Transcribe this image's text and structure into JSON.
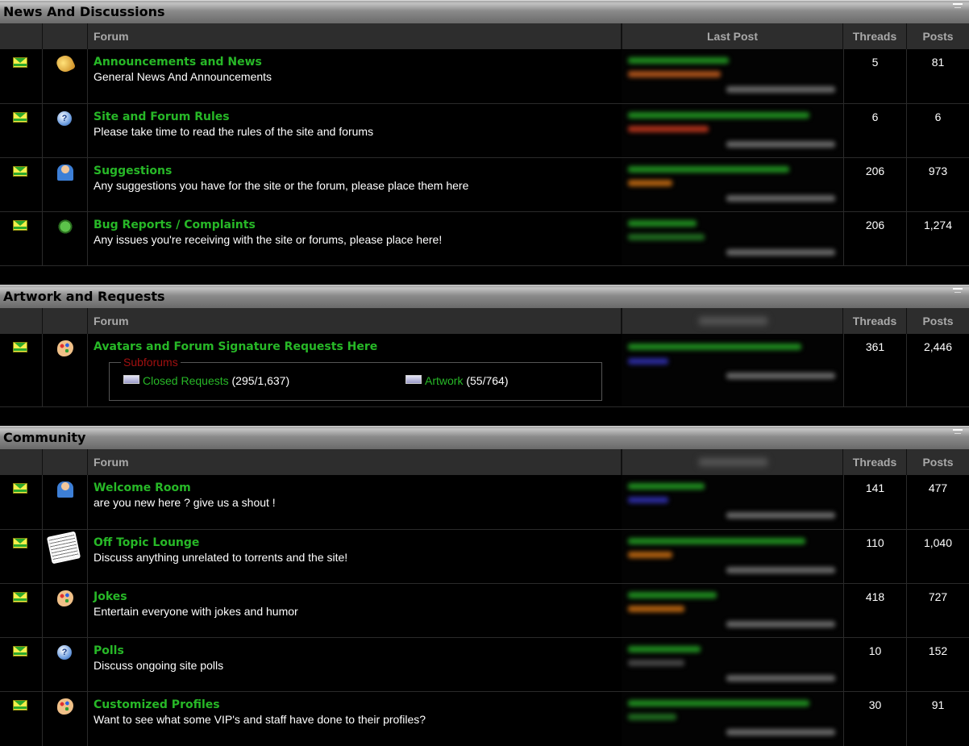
{
  "columns": {
    "forum": "Forum",
    "last_post": "Last Post",
    "threads": "Threads",
    "posts": "Posts"
  },
  "sections": [
    {
      "title": "News And Discussions",
      "forums": [
        {
          "title": "Announcements and News",
          "desc": "General News And Announcements",
          "threads": "5",
          "posts": "81",
          "icon": "bell-icon"
        },
        {
          "title": "Site and Forum Rules",
          "desc": "Please take time to read the rules of the site and forums",
          "threads": "6",
          "posts": "6",
          "icon": "help-icon"
        },
        {
          "title": "Suggestions",
          "desc": "Any suggestions you have for the site or the forum, please place them here",
          "threads": "206",
          "posts": "973",
          "icon": "user-icon"
        },
        {
          "title": "Bug Reports / Complaints",
          "desc": "Any issues you're receiving with the site or forums, please place here!",
          "threads": "206",
          "posts": "1,274",
          "icon": "bug-icon"
        }
      ]
    },
    {
      "title": "Artwork and Requests",
      "forums": [
        {
          "title": "Avatars and Forum Signature Requests Here",
          "desc": "",
          "threads": "361",
          "posts": "2,446",
          "icon": "palette-icon",
          "subforums_label": "Subforums",
          "subforums": [
            {
              "name": "Closed Requests",
              "counts": "(295/1,637)"
            },
            {
              "name": "Artwork",
              "counts": "(55/764)"
            }
          ]
        }
      ]
    },
    {
      "title": "Community",
      "forums": [
        {
          "title": "Welcome Room",
          "desc": "are you new here ? give us a shout !",
          "threads": "141",
          "posts": "477",
          "icon": "user-icon"
        },
        {
          "title": "Off Topic Lounge",
          "desc": "Discuss anything unrelated to torrents and the site!",
          "threads": "110",
          "posts": "1,040",
          "icon": "newspaper-icon"
        },
        {
          "title": "Jokes",
          "desc": "Entertain everyone with jokes and humor",
          "threads": "418",
          "posts": "727",
          "icon": "palette-icon"
        },
        {
          "title": "Polls",
          "desc": "Discuss ongoing site polls",
          "threads": "10",
          "posts": "152",
          "icon": "help-icon"
        },
        {
          "title": "Customized Profiles",
          "desc": "Want to see what some VIP's and staff have done to their profiles?",
          "threads": "30",
          "posts": "91",
          "icon": "palette-icon"
        }
      ]
    }
  ]
}
